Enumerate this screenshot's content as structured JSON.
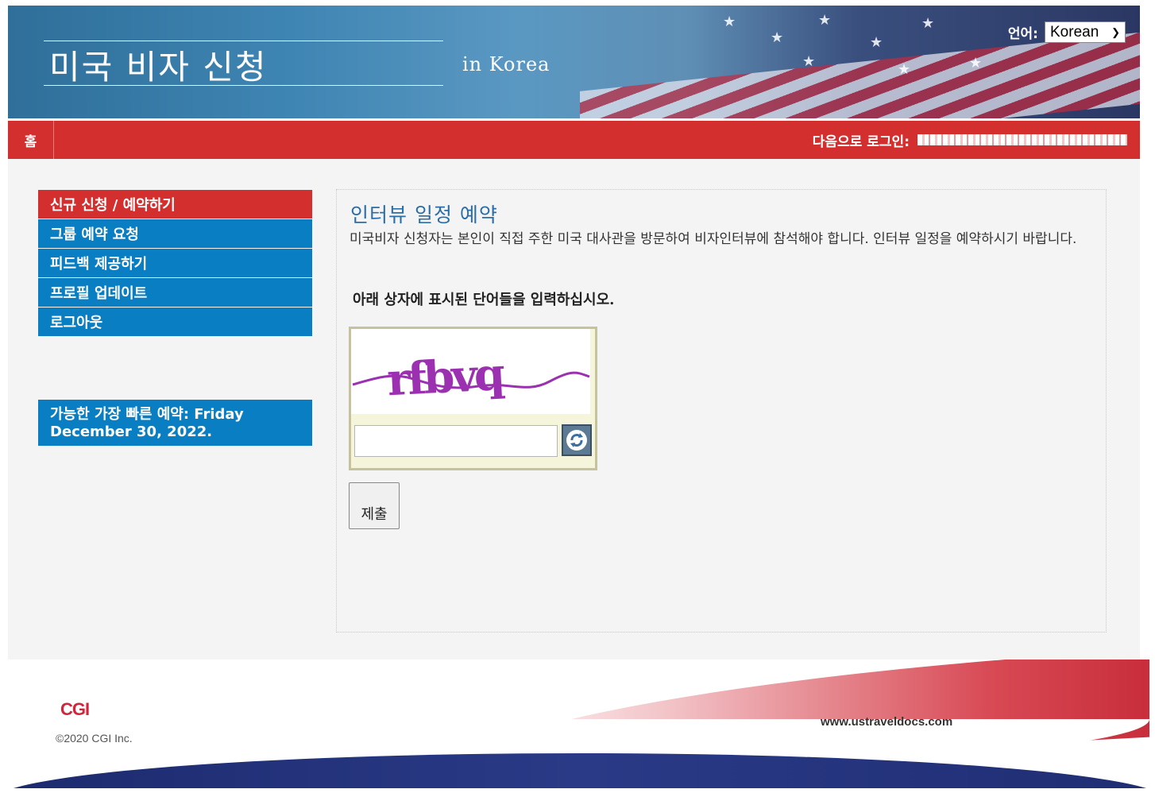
{
  "header": {
    "title": "미국 비자 신청",
    "subtitle": "in  Korea",
    "language_label": "언어:",
    "language_selected": "Korean"
  },
  "nav": {
    "home": "홈",
    "login_label": "다음으로 로그인:"
  },
  "sidebar": {
    "items": [
      {
        "label": "신규 신청 / 예약하기",
        "active": true
      },
      {
        "label": "그룹 예약 요청",
        "active": false
      },
      {
        "label": "피드백 제공하기",
        "active": false
      },
      {
        "label": "프로필 업데이트",
        "active": false
      },
      {
        "label": "로그아웃",
        "active": false
      }
    ],
    "earliest_appointment": "가능한 가장 빠른 예약: Friday December 30, 2022."
  },
  "content": {
    "title": "인터뷰 일정 예약",
    "description": "미국비자 신청자는 본인이 직접 주한 미국 대사관을 방문하여 비자인터뷰에 참석해야 합니다. 인터뷰 일정을 예약하시기 바랍니다.",
    "captcha_prompt": "아래 상자에 표시된 단어들을 입력하십시오.",
    "captcha_text": "rfbvq",
    "captcha_input_value": "",
    "submit_label": "제출"
  },
  "footer": {
    "logo": "CGI",
    "copyright": "©2020 CGI Inc.",
    "url": "www.ustraveldocs.com"
  },
  "colors": {
    "red": "#d32f2f",
    "blue": "#0a7ec2",
    "title_blue": "#2a6ea8",
    "captcha_purple": "#9b30b0"
  }
}
